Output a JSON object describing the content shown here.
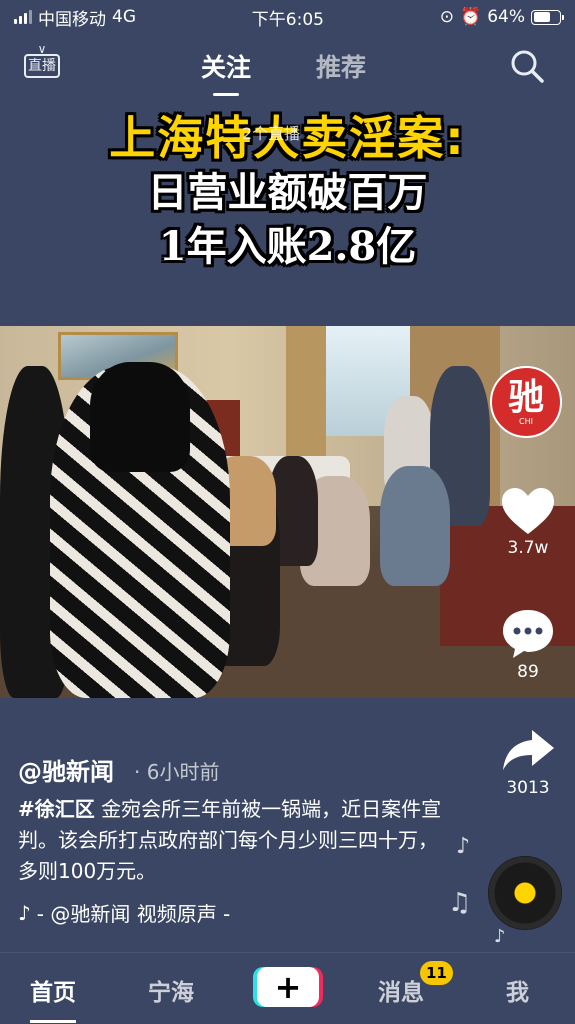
{
  "status_bar": {
    "carrier": "中国移动",
    "network": "4G",
    "time": "下午6:05",
    "battery_percent": "64%",
    "battery_level": 0.64
  },
  "top_nav": {
    "live_label": "直播",
    "tabs": [
      "关注",
      "推荐"
    ],
    "active_tab": "关注",
    "live_count": "2个直播"
  },
  "video": {
    "headline_1": "上海特大卖淫案:",
    "headline_2": "日营业额破百万",
    "headline_3": "1年入账2.8亿"
  },
  "actions": {
    "avatar_char": "驰",
    "avatar_sub": "CHI",
    "likes": "3.7w",
    "comments": "89",
    "shares": "3013"
  },
  "caption": {
    "author": "@驰新闻",
    "time": "· 6小时前",
    "hashtag": "#徐汇区",
    "text": " 金宛会所三年前被一锅端，近日案件宣判。该会所打点政府部门每个月少则三四十万，多则100万元。",
    "music": "- @驰新闻   视频原声 -"
  },
  "bottom_bar": {
    "home": "首页",
    "city": "宁海",
    "plus": "+",
    "messages": "消息",
    "messages_badge": "11",
    "me": "我"
  },
  "colors": {
    "background": "#3a4663",
    "headline_yellow": "#ffd400",
    "avatar_red": "#d42b2b",
    "badge_yellow": "#f7c600"
  }
}
